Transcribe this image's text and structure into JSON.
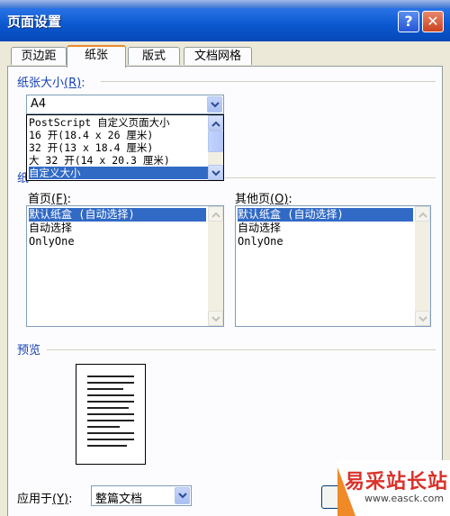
{
  "window": {
    "title": "页面设置"
  },
  "titlebar": {
    "help": "?",
    "close": "✕"
  },
  "tabs": [
    {
      "label": "页边距"
    },
    {
      "label": "纸张"
    },
    {
      "label": "版式"
    },
    {
      "label": "文档网格"
    }
  ],
  "paper_size": {
    "label": "纸张大小",
    "hotkey": "(R)",
    "colon": ":",
    "selected": "A4",
    "options": [
      "PostScript 自定义页面大小",
      "16 开(18.4 x 26 厘米)",
      "32 开(13 x 18.4 厘米)",
      "大 32 开(14 x 20.3 厘米)",
      "自定义大小"
    ]
  },
  "paper_source": {
    "label": "纸",
    "first_page": {
      "label": "首页",
      "hotkey": "(F)",
      "colon": ":",
      "items": [
        "默认纸盒 (自动选择)",
        "自动选择",
        "OnlyOne"
      ]
    },
    "other_pages": {
      "label": "其他页",
      "hotkey": "(O)",
      "colon": ":",
      "items": [
        "默认纸盒 (自动选择)",
        "自动选择",
        "OnlyOne"
      ]
    }
  },
  "preview": {
    "label": "预览"
  },
  "apply_to": {
    "label": "应用于",
    "hotkey": "(Y)",
    "colon": ":",
    "selected": "整篇文档"
  },
  "watermark": {
    "text": "易采站长站",
    "url": "www.easck.com"
  },
  "colors": {
    "selection": "#316ac5",
    "group_label": "#1540b8",
    "title_bar": "#0a58cf"
  }
}
